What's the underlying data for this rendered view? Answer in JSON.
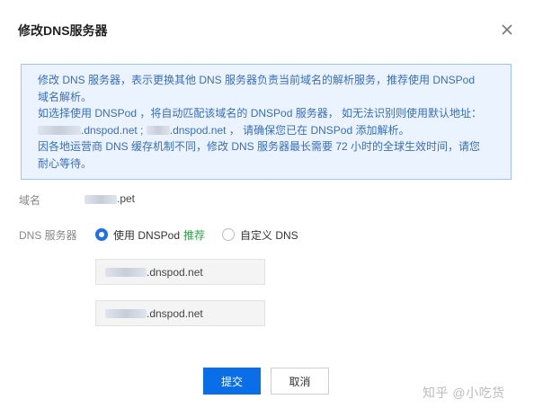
{
  "dialog": {
    "title": "修改DNS服务器",
    "close_icon": "close-icon"
  },
  "notice": {
    "line1": "修改 DNS 服务器，表示更换其他 DNS 服务器负责当前域名的解析服务，推荐使用 DNSPod",
    "line2": "域名解析。",
    "line3": "如选择使用 DNSPod ，将自动匹配该域名的 DNSPod 服务器， 如无法识别则使用默认地址：",
    "line4_part1": ".dnspod.net ;",
    "line4_part2": ".dnspod.net ， 请确保您已在 DNSPod 添加解析。",
    "line5": "因各地运营商 DNS 缓存机制不同，修改 DNS 服务器最长需要 72 小时的全球生效时间，请您",
    "line6": "耐心等待。"
  },
  "domain": {
    "label": "域名",
    "value_suffix": ".pet"
  },
  "dns": {
    "label": "DNS 服务器",
    "option_dnspod": "使用 DNSPod",
    "option_recommend": "推荐",
    "option_custom": "自定义 DNS",
    "selected": "dnspod",
    "server1_suffix": ".dnspod.net",
    "server2_suffix": ".dnspod.net"
  },
  "buttons": {
    "submit": "提交",
    "cancel": "取消"
  },
  "watermark": "知乎 @小吃货",
  "colors": {
    "primary": "#0a6ee8",
    "recommend": "#2ba346",
    "notice_bg": "#eaf3ff",
    "notice_text": "#3b6fb6"
  }
}
